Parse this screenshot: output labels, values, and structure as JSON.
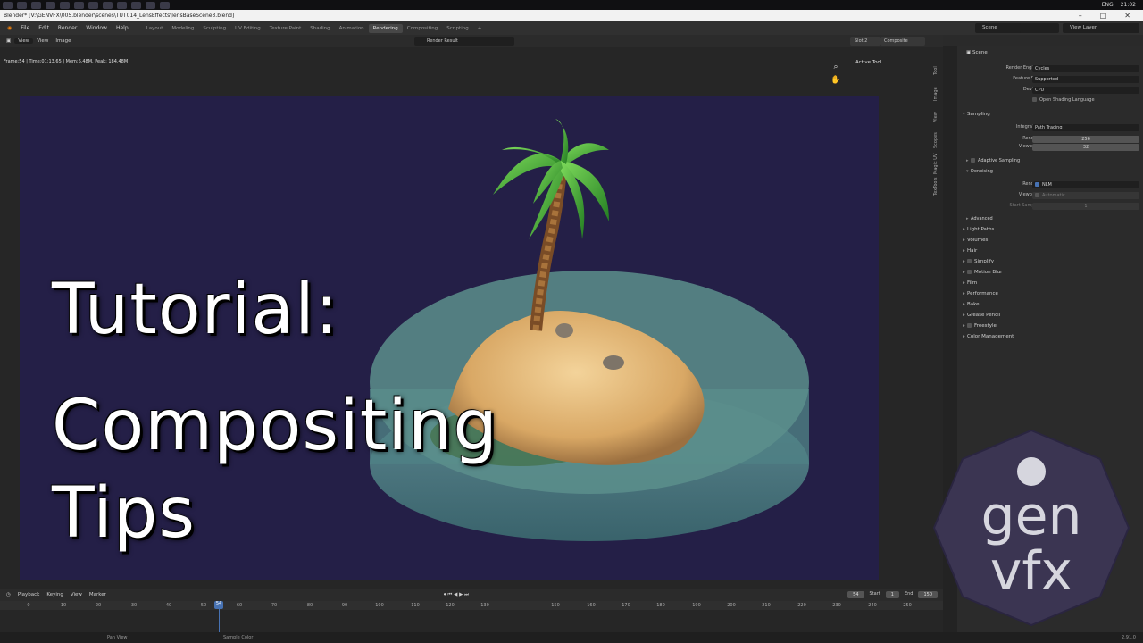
{
  "window": {
    "title": "Blender* [V:\\GENVFX\\005.blender\\scenes\\TUT014_LensEffects\\lensBaseScene3.blend]",
    "clock": "21:02",
    "lang": "ENG"
  },
  "menu": [
    "File",
    "Edit",
    "Render",
    "Window",
    "Help"
  ],
  "workspaces": [
    "Layout",
    "Modeling",
    "Sculpting",
    "UV Editing",
    "Texture Paint",
    "Shading",
    "Animation",
    "Rendering",
    "Compositing",
    "Scripting"
  ],
  "active_workspace": "Rendering",
  "scene_name": "Scene",
  "view_layer": "View Layer",
  "image_editor": {
    "menus": [
      "View",
      "View",
      "Image"
    ],
    "image_name": "Render Result",
    "slot": "Slot 2",
    "pass": "Composite",
    "frame_info": "Frame:54 | Time:01:13.65 | Mem:6.48M, Peak: 184.48M",
    "active_tool": "Active Tool"
  },
  "side_tabs": [
    "Tool",
    "Image",
    "View",
    "Scopes",
    "Magic UV",
    "TexTools"
  ],
  "overlay_title": [
    "Tutorial:",
    "Compositing",
    "Tips"
  ],
  "properties": {
    "header": "Scene",
    "render_engine_label": "Render Engine",
    "render_engine": "Cycles",
    "feature_set_label": "Feature Set",
    "feature_set": "Supported",
    "device_label": "Device",
    "device": "CPU",
    "osl_label": "Open Shading Language",
    "sampling": "Sampling",
    "integrator_label": "Integrator",
    "integrator": "Path Tracing",
    "render_label": "Render",
    "render_samples": "256",
    "viewport_label": "Viewport",
    "viewport_samples": "32",
    "adaptive_sampling": "Adaptive Sampling",
    "denoising": "Denoising",
    "denoise_render_label": "Render",
    "denoise_render": "NLM",
    "denoise_viewport_label": "Viewport",
    "denoise_viewport": "Automatic",
    "start_sample_label": "Start Sample",
    "start_sample": "1",
    "advanced": "Advanced",
    "panels": [
      "Light Paths",
      "Volumes",
      "Hair",
      "Simplify",
      "Motion Blur",
      "Film",
      "Performance",
      "Bake",
      "Grease Pencil",
      "Freestyle",
      "Color Management"
    ]
  },
  "timeline": {
    "menus": [
      "Playback",
      "Keying",
      "View",
      "Marker"
    ],
    "current_frame": "54",
    "start_label": "Start",
    "start": "1",
    "end_label": "End",
    "end": "150",
    "ticks": [
      "0",
      "10",
      "20",
      "30",
      "40",
      "50",
      "60",
      "70",
      "80",
      "90",
      "100",
      "110",
      "120",
      "130",
      "150",
      "160",
      "170",
      "180",
      "190",
      "200",
      "210",
      "220",
      "230",
      "240",
      "250"
    ]
  },
  "status": {
    "pan": "Pan View",
    "sample": "Sample Color",
    "version": "2.91.0"
  },
  "logo": {
    "line1": "gen",
    "line2": "vfx"
  },
  "colors": {
    "render_bg": "#241f47",
    "accent": "#4772b3",
    "logo_bg": "#3b3552"
  }
}
